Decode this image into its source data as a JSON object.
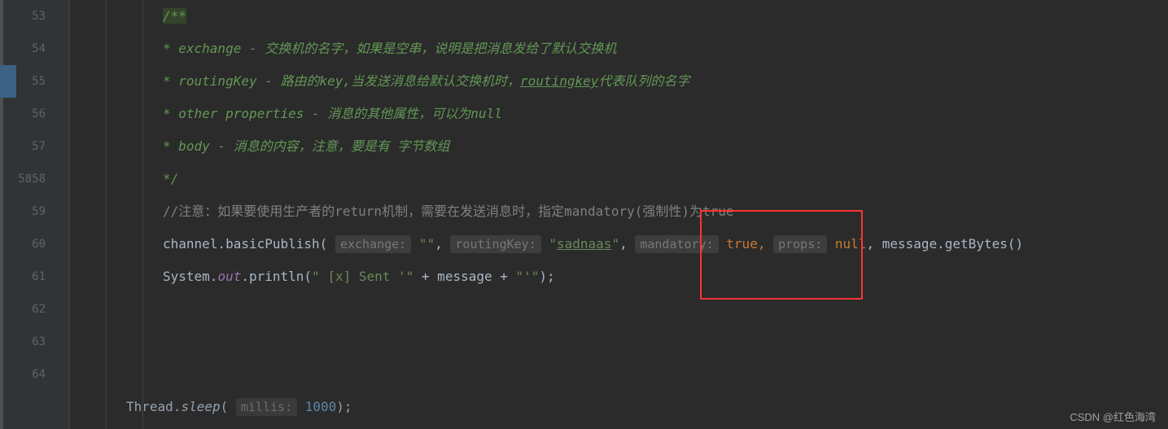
{
  "gutter": {
    "lines": [
      "53",
      "54",
      "55",
      "56",
      "57",
      "58",
      "59",
      "60",
      "61",
      "62",
      "63",
      "64"
    ]
  },
  "code": {
    "line53": "/**",
    "line54_pre": " * exchange - ",
    "line54_txt": "交换机的名字，如果是空串，说明是把消息发给了默认交换机",
    "line55_pre": " * routingKey - ",
    "line55_txt": "路由的key,当发送消息给默认交换机时，",
    "line55_link": "routingkey",
    "line55_txt2": "代表队列的名字",
    "line56_pre": " * other properties - ",
    "line56_txt": "消息的其他属性，可以为null",
    "line57_pre": " * body - ",
    "line57_txt": "消息的内容，注意，要是有 字节数组",
    "line58": " */",
    "line59_pre": "//",
    "line59_txt": "注意：如果要使用生产者的return机制，需要在发送消息时，指定mandatory(强制性)为true",
    "line60_obj": "channel.basicPublish(",
    "line60_hint1": "exchange:",
    "line60_val1": " \"\"",
    "line60_comma": ", ",
    "line60_hint2": "routingKey:",
    "line60_val2_pre": " \"",
    "line60_val2": "sadnaas",
    "line60_val2_post": "\"",
    "line60_hint3": "mandatory:",
    "line60_val3": " true",
    "line60_hint4": "props:",
    "line60_val4": " null",
    "line60_end": ", message.getBytes()",
    "line61_pre": "System.",
    "line61_out": "out",
    "line61_print": ".println(",
    "line61_str1": "\" [x] Sent '\"",
    "line61_plus": " + message + ",
    "line61_str2": "\"'\"",
    "line61_end": ");",
    "line65_pre": "Thread.",
    "line65_sleep": "sleep",
    "line65_open": "(",
    "line65_hint": "millis:",
    "line65_val": " 1000",
    "line65_end": ");"
  },
  "watermark": "CSDN @红色海湾"
}
